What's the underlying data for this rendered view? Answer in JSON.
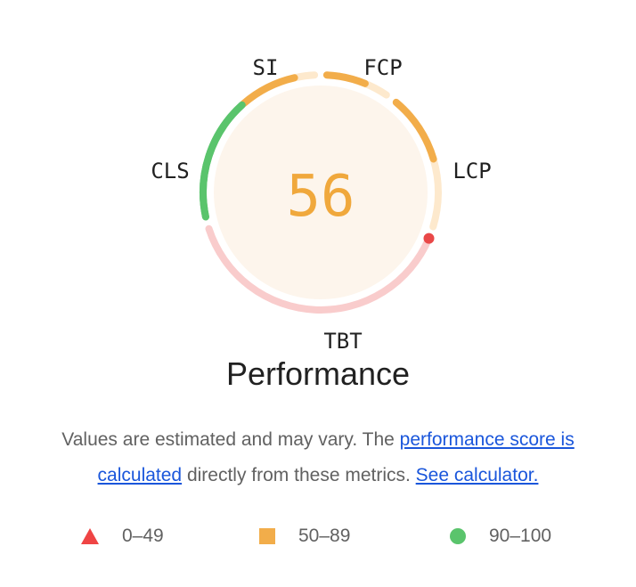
{
  "gauge": {
    "score": "56",
    "score_color": "#f0a83c",
    "inner_fill": "#fdf5ec",
    "metrics": [
      {
        "id": "si",
        "label": "SI",
        "level": "average",
        "fill": 0.74
      },
      {
        "id": "fcp",
        "label": "FCP",
        "level": "average",
        "fill": 0.62
      },
      {
        "id": "lcp",
        "label": "LCP",
        "level": "average",
        "fill": 0.5
      },
      {
        "id": "tbt",
        "label": "TBT",
        "level": "fail",
        "fill": 0.0
      },
      {
        "id": "cls",
        "label": "CLS",
        "level": "pass",
        "fill": 1.0
      }
    ],
    "colors": {
      "pass": "#5ac46c",
      "average": "#f2ad4a",
      "average_light": "#fde9cd",
      "fail": "#e94848",
      "fail_light": "#f9cccc"
    }
  },
  "title": "Performance",
  "description": {
    "text_before": "Values are estimated and may vary. The ",
    "link1": "performance score is calculated",
    "text_middle": " directly from these metrics. ",
    "link2": "See calculator."
  },
  "legend": [
    {
      "shape": "triangle",
      "range": "0–49",
      "color": "#ef4444"
    },
    {
      "shape": "square",
      "range": "50–89",
      "color": "#f2ad4a"
    },
    {
      "shape": "circle",
      "range": "90–100",
      "color": "#5ac46c"
    }
  ]
}
